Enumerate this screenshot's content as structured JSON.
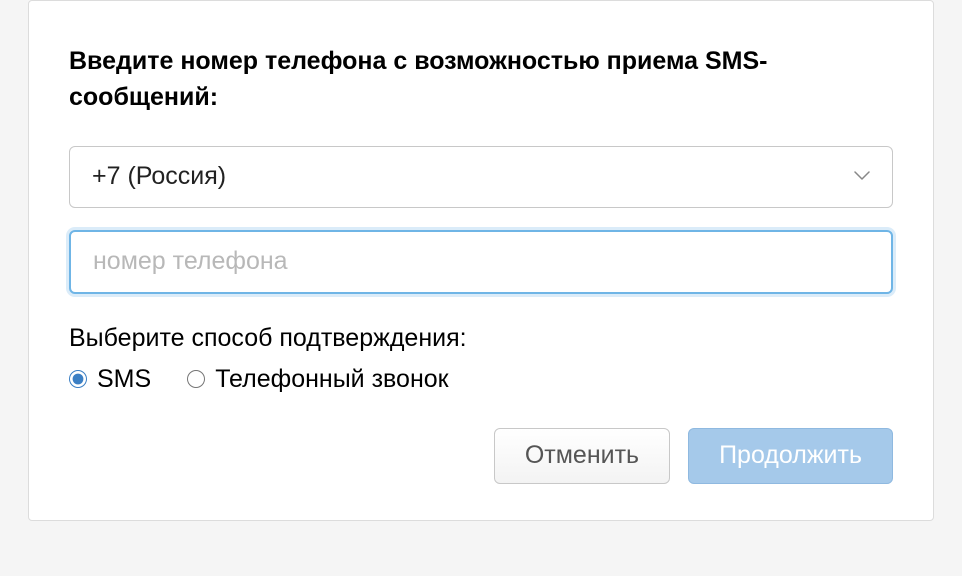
{
  "instruction": "Введите номер телефона с возможностью приема SMS-сообщений:",
  "country": {
    "selected": "+7 (Россия)"
  },
  "phone": {
    "placeholder": "номер телефона",
    "value": ""
  },
  "verification": {
    "label": "Выберите способ подтверждения:",
    "options": {
      "sms": "SMS",
      "call": "Телефонный звонок"
    },
    "selected": "sms"
  },
  "buttons": {
    "cancel": "Отменить",
    "continue": "Продолжить"
  }
}
